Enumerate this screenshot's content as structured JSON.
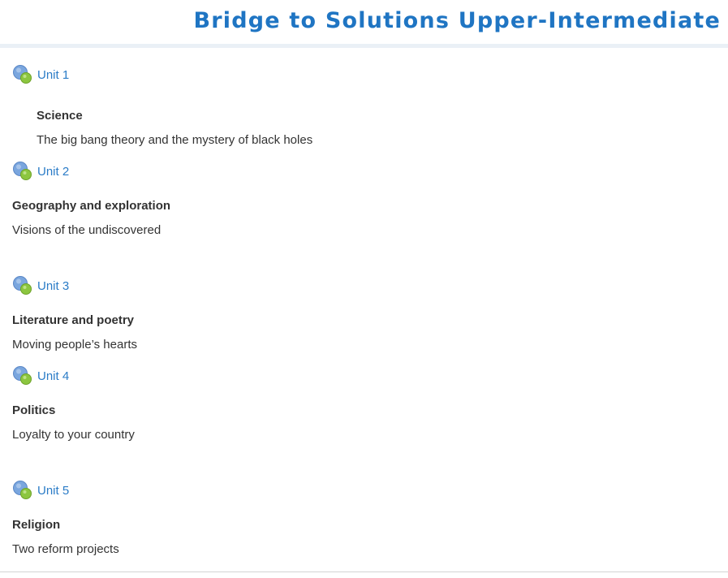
{
  "page": {
    "title": "Bridge to Solutions Upper-Intermediate"
  },
  "colors": {
    "title": "#1f75c3",
    "link": "#2b7cc7",
    "icon_blue": "#7aa6de",
    "icon_green": "#8cc63f",
    "text": "#333333"
  },
  "icons": {
    "unit_activity": "activity-status-icon"
  },
  "units": [
    {
      "label": "Unit 1",
      "topic": "Science",
      "summary": "The big bang theory and the mystery of black holes"
    },
    {
      "label": "Unit 2",
      "topic": "Geography and exploration",
      "summary": "Visions of the undiscovered"
    },
    {
      "label": "Unit 3",
      "topic": "Literature and poetry",
      "summary": "Moving people’s hearts"
    },
    {
      "label": "Unit 4",
      "topic": "Politics",
      "summary": "Loyalty to your country"
    },
    {
      "label": "Unit 5",
      "topic": "Religion",
      "summary": "Two reform projects"
    }
  ]
}
